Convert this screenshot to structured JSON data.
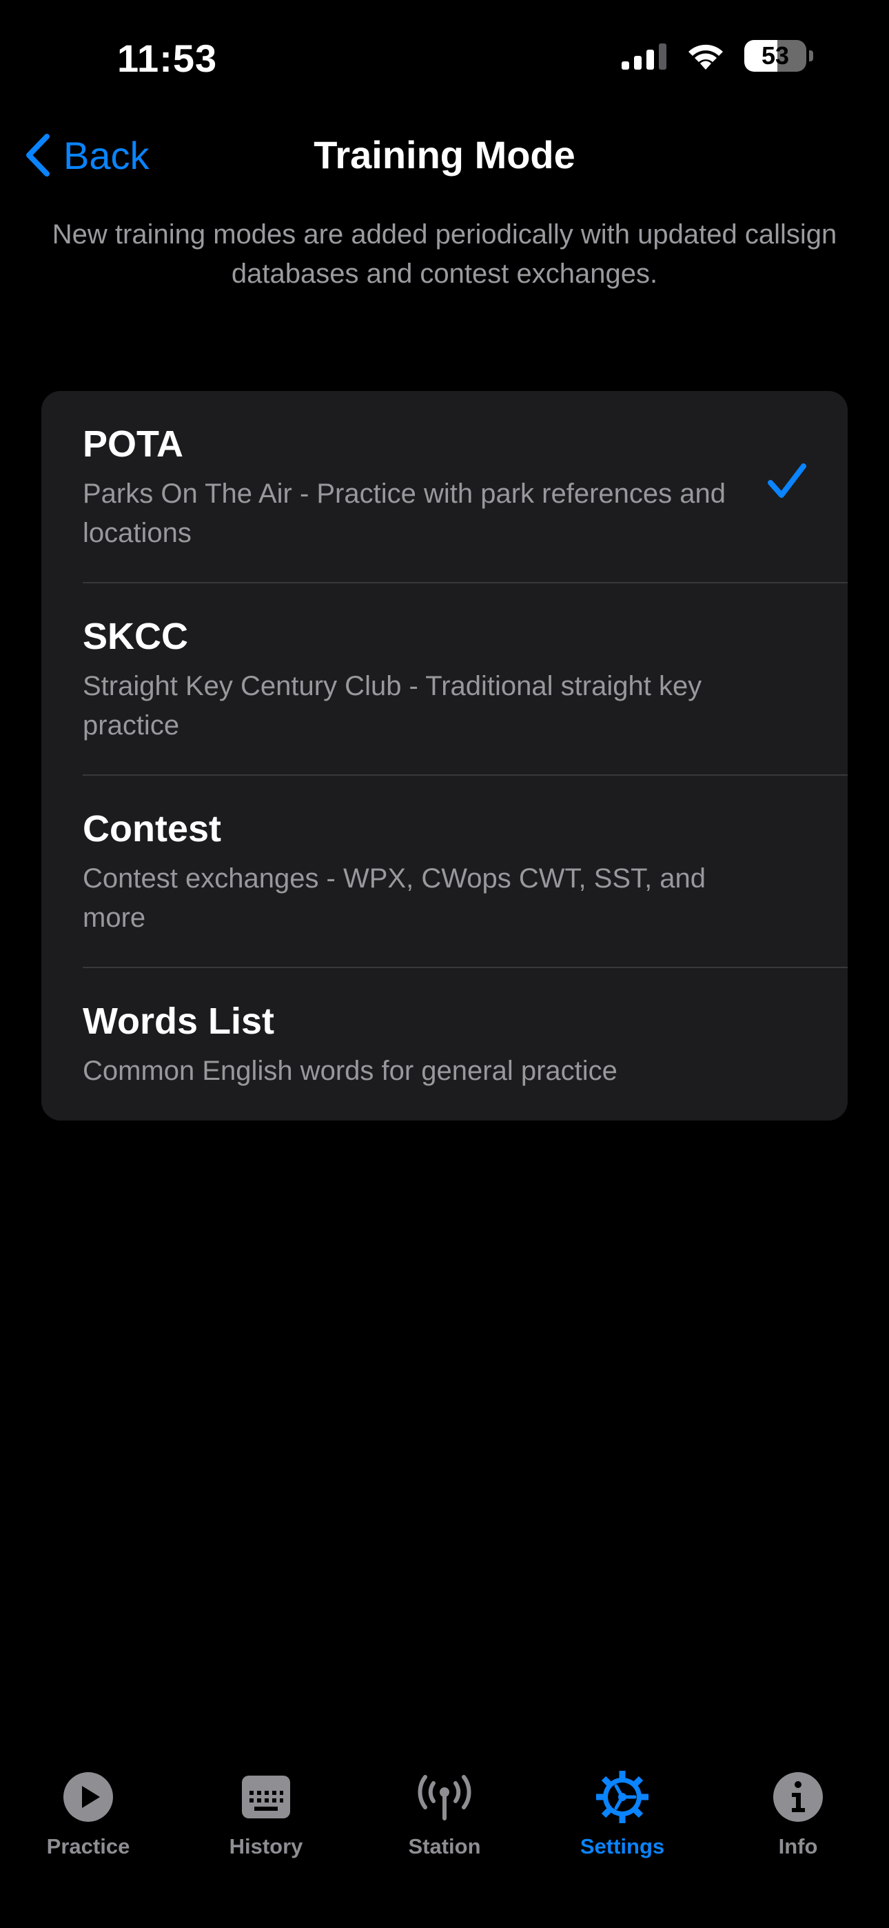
{
  "status_bar": {
    "time": "11:53",
    "battery_percent": "53",
    "battery_level": 0.53
  },
  "nav": {
    "back_label": "Back",
    "title": "Training Mode"
  },
  "description": "New training modes are added periodically with updated callsign databases and contest exchanges.",
  "modes": [
    {
      "title": "POTA",
      "subtitle": "Parks On The Air - Practice with park references and locations",
      "selected": true
    },
    {
      "title": "SKCC",
      "subtitle": "Straight Key Century Club - Traditional straight key practice",
      "selected": false
    },
    {
      "title": "Contest",
      "subtitle": "Contest exchanges - WPX, CWops CWT, SST, and more",
      "selected": false
    },
    {
      "title": "Words List",
      "subtitle": "Common English words for general practice",
      "selected": false
    }
  ],
  "tabs": [
    {
      "label": "Practice",
      "icon": "play-circle-icon",
      "active": false
    },
    {
      "label": "History",
      "icon": "keyboard-icon",
      "active": false
    },
    {
      "label": "Station",
      "icon": "antenna-icon",
      "active": false
    },
    {
      "label": "Settings",
      "icon": "gear-icon",
      "active": true
    },
    {
      "label": "Info",
      "icon": "info-circle-icon",
      "active": false
    }
  ],
  "colors": {
    "accent": "#0a84ff",
    "inactive": "#8e8e93",
    "card": "#1c1c1e",
    "background": "#000000"
  }
}
